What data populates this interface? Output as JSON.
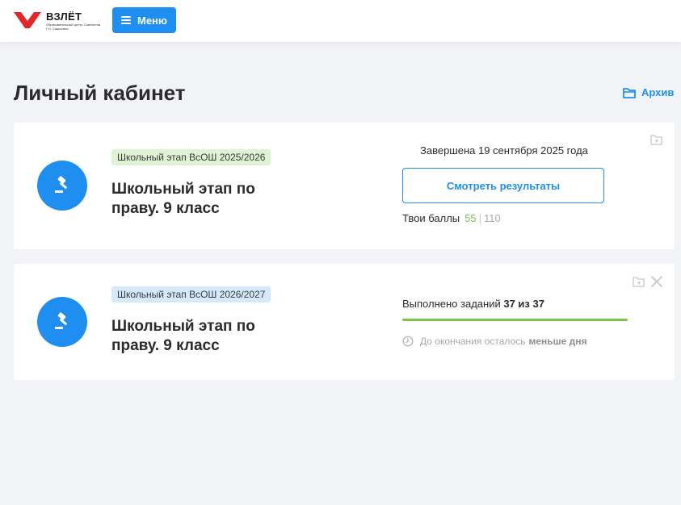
{
  "header": {
    "logo_title": "ВЗЛЁТ",
    "logo_subtitle": "Образовательный центр Самолетов Г.Н. Сашалина",
    "menu_label": "Меню"
  },
  "page": {
    "title": "Личный кабинет",
    "archive_label": "Архив"
  },
  "colors": {
    "accent": "#1e8ff0",
    "success": "#7bc44b",
    "badge_green": "#dff2d3",
    "badge_blue": "#d4e9fb"
  },
  "cards": [
    {
      "badge": "Школьный этап ВсОШ 2025/2026",
      "badge_color": "green",
      "title": "Школьный этап по праву. 9 класс",
      "icon": "gavel-icon",
      "status": "Завершена 19 сентября 2025 года",
      "button_label": "Смотреть результаты",
      "score_label": "Твои баллы",
      "score_value": "55",
      "score_separator": "|",
      "score_max": "110"
    },
    {
      "badge": "Школьный этап ВсОШ 2026/2027",
      "badge_color": "blue",
      "title": "Школьный этап по праву. 9 класс",
      "icon": "gavel-icon",
      "progress_prefix": "Выполнено заданий",
      "progress_value": "37 из 37",
      "progress_fraction": 1.0,
      "time_left_prefix": "До окончания осталось",
      "time_left_value": "меньше дня"
    }
  ]
}
